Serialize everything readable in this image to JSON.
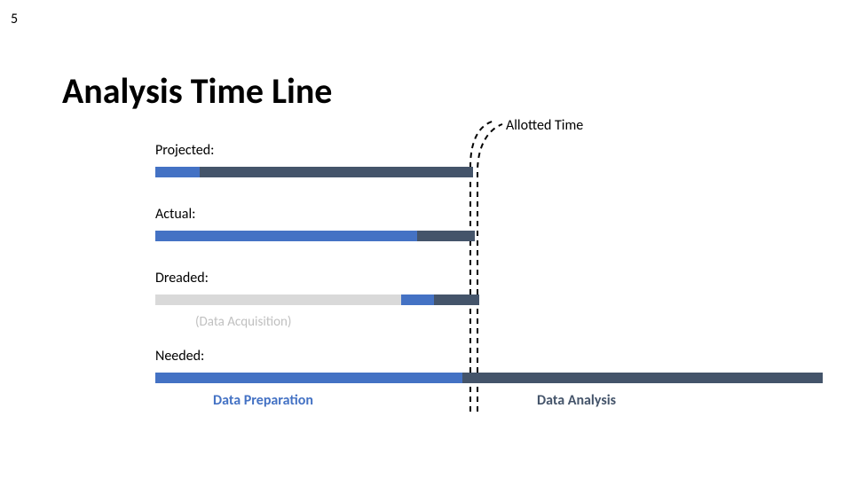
{
  "page_number": "5",
  "title": "Analysis Time Line",
  "allotted_time_label": "Allotted Time",
  "labels": {
    "projected": "Projected:",
    "actual": "Actual:",
    "dreaded": "Dreaded:",
    "needed": "Needed:"
  },
  "acquisition_label": "(Data Acquisition)",
  "legend": {
    "prep": "Data Preparation",
    "analysis": "Data Analysis"
  },
  "colors": {
    "blue": "#4472c4",
    "dark": "#44546a",
    "grey": "#d9d9d9"
  },
  "chart_data": {
    "type": "bar",
    "orientation": "horizontal",
    "note": "Each row is a stacked horizontal bar. Percentages sum to 100 and are of that row's total width (row widths differ).",
    "allotted_time_marker_percent_of_needed": 48,
    "rows": [
      {
        "name": "Projected",
        "row_width_percent_of_needed": 47.5,
        "segments": [
          {
            "label": "Data Preparation",
            "color": "blue",
            "percent": 14
          },
          {
            "label": "Data Analysis",
            "color": "dark",
            "percent": 86
          }
        ]
      },
      {
        "name": "Actual",
        "row_width_percent_of_needed": 48,
        "segments": [
          {
            "label": "Data Preparation",
            "color": "blue",
            "percent": 82
          },
          {
            "label": "Data Analysis",
            "color": "dark",
            "percent": 18
          }
        ]
      },
      {
        "name": "Dreaded",
        "row_width_percent_of_needed": 48.5,
        "segments": [
          {
            "label": "Data Acquisition",
            "color": "grey",
            "percent": 76
          },
          {
            "label": "Data Preparation",
            "color": "blue",
            "percent": 10
          },
          {
            "label": "Data Analysis",
            "color": "dark",
            "percent": 14
          }
        ]
      },
      {
        "name": "Needed",
        "row_width_percent_of_needed": 100,
        "segments": [
          {
            "label": "Data Preparation",
            "color": "blue",
            "percent": 46
          },
          {
            "label": "Data Analysis",
            "color": "dark",
            "percent": 54
          }
        ]
      }
    ]
  }
}
